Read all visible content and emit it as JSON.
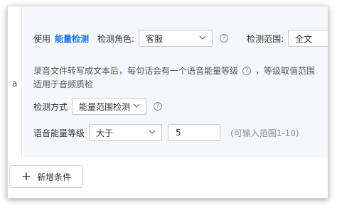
{
  "side_marker": "a",
  "row1": {
    "use_label": "使用",
    "detection_link": "能量检测",
    "role_label": "检测角色:",
    "role_value": "客服",
    "range_label": "检测范围:",
    "range_value": "全文"
  },
  "description": {
    "line1": "录音文件转写成文本后，每句话会有一个语音能量等级",
    "line1_tail": "，等级取值范围",
    "line2": "适用于音频质检"
  },
  "method": {
    "label": "检测方式",
    "value": "能量范围检测"
  },
  "level": {
    "label": "语音能量等级",
    "operator": "大于",
    "value": "5",
    "hint": "(可输入范围1-10)"
  },
  "add_button": {
    "icon": "+",
    "label": "新增条件"
  },
  "icons": {
    "help": "?"
  }
}
